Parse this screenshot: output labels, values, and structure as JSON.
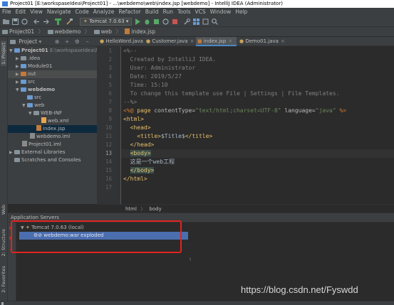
{
  "window": {
    "title": "Project01 [E:\\workspaseIdea\\Project01] - ...\\webdemo\\web\\index.jsp [webdemo] - IntelliJ IDEA (Administrator)"
  },
  "menu": [
    "File",
    "Edit",
    "View",
    "Navigate",
    "Code",
    "Analyze",
    "Refactor",
    "Build",
    "Run",
    "Tools",
    "VCS",
    "Window",
    "Help"
  ],
  "toolbar": {
    "run_config": "Tomcat 7.0.63"
  },
  "breadcrumb": [
    "Project01",
    "webdemo",
    "web",
    "index.jsp"
  ],
  "left_strip": {
    "project": "1: Project",
    "web": "Web",
    "structure": "2: Structure",
    "favorites": "2: Favorites"
  },
  "project_panel": {
    "title": "Project",
    "tree": [
      {
        "label": "Project01",
        "path": "E:\\workspaseIdea\\Pr",
        "depth": 0,
        "expanded": true,
        "kind": "module"
      },
      {
        "label": ".idea",
        "depth": 1,
        "expanded": false,
        "kind": "folder"
      },
      {
        "label": "Module01",
        "depth": 1,
        "expanded": false,
        "kind": "module"
      },
      {
        "label": "out",
        "depth": 1,
        "expanded": false,
        "kind": "folder-excluded"
      },
      {
        "label": "src",
        "depth": 1,
        "expanded": false,
        "kind": "folder-src"
      },
      {
        "label": "webdemo",
        "depth": 1,
        "expanded": true,
        "kind": "module"
      },
      {
        "label": "src",
        "depth": 2,
        "expanded": false,
        "kind": "folder-src"
      },
      {
        "label": "web",
        "depth": 2,
        "expanded": true,
        "kind": "folder-web"
      },
      {
        "label": "WEB-INF",
        "depth": 3,
        "expanded": true,
        "kind": "folder"
      },
      {
        "label": "web.xml",
        "depth": 4,
        "kind": "xml"
      },
      {
        "label": "index.jsp",
        "depth": 3,
        "kind": "jsp",
        "selected": true
      },
      {
        "label": "webdemo.iml",
        "depth": 2,
        "kind": "iml"
      },
      {
        "label": "Project01.iml",
        "depth": 1,
        "kind": "iml"
      },
      {
        "label": "External Libraries",
        "depth": 0,
        "expanded": false,
        "kind": "lib"
      },
      {
        "label": "Scratches and Consoles",
        "depth": 0,
        "kind": "scratch"
      }
    ]
  },
  "tabs": [
    {
      "label": "HelloWord.java",
      "active": false
    },
    {
      "label": "Customer.java",
      "active": false
    },
    {
      "label": "index.jsp",
      "active": true
    },
    {
      "label": "Demo01.java",
      "active": false
    }
  ],
  "editor": {
    "lines": [
      {
        "n": "1",
        "parts": [
          {
            "t": "<%--",
            "c": "c-comment"
          }
        ]
      },
      {
        "n": "2",
        "parts": [
          {
            "t": "  Created by IntelliJ IDEA.",
            "c": "c-comment"
          }
        ]
      },
      {
        "n": "3",
        "parts": [
          {
            "t": "  User: Administrator",
            "c": "c-comment"
          }
        ]
      },
      {
        "n": "4",
        "parts": [
          {
            "t": "  Date: 2019/5/27",
            "c": "c-comment"
          }
        ]
      },
      {
        "n": "5",
        "parts": [
          {
            "t": "  Time: 15:10",
            "c": "c-comment"
          }
        ]
      },
      {
        "n": "6",
        "parts": [
          {
            "t": "  To change this template use File | Settings | File Templates.",
            "c": "c-comment"
          }
        ]
      },
      {
        "n": "7",
        "parts": [
          {
            "t": "--%>",
            "c": "c-comment"
          }
        ]
      },
      {
        "n": "8",
        "parts": [
          {
            "t": "<%@ ",
            "c": "c-dir"
          },
          {
            "t": "page ",
            "c": "c-tag"
          },
          {
            "t": "contentType=",
            "c": "c-attr"
          },
          {
            "t": "\"text/html;charset=UTF-8\"",
            "c": "c-str"
          },
          {
            "t": " language=",
            "c": "c-attr"
          },
          {
            "t": "\"java\"",
            "c": "c-str"
          },
          {
            "t": " %>",
            "c": "c-dir"
          }
        ]
      },
      {
        "n": "9",
        "parts": [
          {
            "t": "<html>",
            "c": "c-tag"
          }
        ]
      },
      {
        "n": "10",
        "parts": [
          {
            "t": "  ",
            "c": "c-text"
          },
          {
            "t": "<head>",
            "c": "c-tag"
          }
        ]
      },
      {
        "n": "11",
        "parts": [
          {
            "t": "    ",
            "c": "c-text"
          },
          {
            "t": "<title>",
            "c": "c-tag"
          },
          {
            "t": "$Title$",
            "c": "c-text"
          },
          {
            "t": "</title>",
            "c": "c-tag"
          }
        ]
      },
      {
        "n": "12",
        "parts": [
          {
            "t": "  ",
            "c": "c-text"
          },
          {
            "t": "</head>",
            "c": "c-tag"
          }
        ]
      },
      {
        "n": "13",
        "parts": [
          {
            "t": "  ",
            "c": "c-text"
          },
          {
            "t": "<body>",
            "c": "c-tag tag-hl"
          }
        ]
      },
      {
        "n": "14",
        "parts": [
          {
            "t": "  这是一个web工程",
            "c": "c-text"
          }
        ]
      },
      {
        "n": "15",
        "parts": [
          {
            "t": "  ",
            "c": "c-text"
          },
          {
            "t": "</body>",
            "c": "c-tag tag-hl"
          }
        ]
      },
      {
        "n": "16",
        "parts": [
          {
            "t": "</html>",
            "c": "c-tag"
          }
        ]
      },
      {
        "n": "17",
        "parts": []
      }
    ],
    "current_line": "13"
  },
  "editor_breadcrumb": [
    "html",
    "body"
  ],
  "app_servers": {
    "title": "Application Servers",
    "server": "Tomcat 7.0.63 (local)",
    "artifact": "webdemo:war exploded"
  },
  "watermark": "https://blog.csdn.net/Fyswdd",
  "colors": {
    "accent": "#4a88c7",
    "selection": "#0d293e",
    "artifact_selection": "#4b6eaf",
    "annotation_box": "#e0241f"
  }
}
